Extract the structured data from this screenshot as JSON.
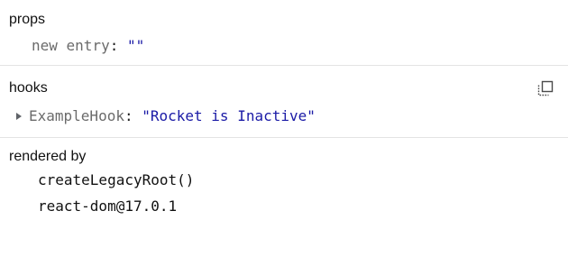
{
  "props": {
    "title": "props",
    "entry_key": "new entry",
    "entry_colon": ": ",
    "entry_value": "\"\""
  },
  "hooks": {
    "title": "hooks",
    "copy_icon": "copy-icon",
    "hook_key": "ExampleHook",
    "hook_colon": ": ",
    "hook_value": "\"Rocket is Inactive\""
  },
  "rendered_by": {
    "title": "rendered by",
    "items": [
      "createLegacyRoot()",
      "react-dom@17.0.1"
    ]
  }
}
